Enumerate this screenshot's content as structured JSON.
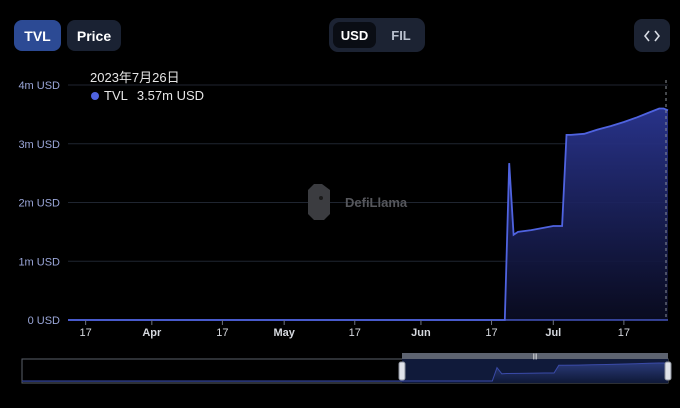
{
  "toolbar": {
    "tvl_label": "TVL",
    "price_label": "Price",
    "denom_usd": "USD",
    "denom_fil": "FIL",
    "embed_icon": "code-brackets-icon"
  },
  "tooltip": {
    "date": "2023年7月26日",
    "series": "TVL",
    "value": "3.57m USD"
  },
  "watermark": "DefiLlama",
  "colors": {
    "background": "#000000",
    "line": "#4f63e0",
    "fill_top": "#2a3590",
    "active_tab": "#2c4a94"
  },
  "chart_data": {
    "type": "area",
    "series": [
      {
        "name": "TVL",
        "x": [
          "2023-03-13",
          "2023-06-20",
          "2023-06-21",
          "2023-06-22",
          "2023-06-23",
          "2023-06-26",
          "2023-07-01",
          "2023-07-03",
          "2023-07-04",
          "2023-07-05",
          "2023-07-08",
          "2023-07-11",
          "2023-07-14",
          "2023-07-17",
          "2023-07-20",
          "2023-07-23",
          "2023-07-25",
          "2023-07-26",
          "2023-07-27"
        ],
        "values": [
          0,
          0,
          2.67,
          1.45,
          1.5,
          1.53,
          1.6,
          1.6,
          3.15,
          3.15,
          3.17,
          3.24,
          3.3,
          3.37,
          3.45,
          3.54,
          3.6,
          3.6,
          3.57
        ]
      }
    ],
    "x_ticks": [
      {
        "date": "2023-03-17",
        "label": "17"
      },
      {
        "date": "2023-04-01",
        "label": "Apr"
      },
      {
        "date": "2023-04-17",
        "label": "17"
      },
      {
        "date": "2023-05-01",
        "label": "May"
      },
      {
        "date": "2023-05-17",
        "label": "17"
      },
      {
        "date": "2023-06-01",
        "label": "Jun"
      },
      {
        "date": "2023-06-17",
        "label": "17"
      },
      {
        "date": "2023-07-01",
        "label": "Jul"
      },
      {
        "date": "2023-07-17",
        "label": "17"
      }
    ],
    "y_ticks": [
      {
        "value": 0,
        "label": "0 USD"
      },
      {
        "value": 1,
        "label": "1m USD"
      },
      {
        "value": 2,
        "label": "2m USD"
      },
      {
        "value": 3,
        "label": "3m USD"
      },
      {
        "value": 4,
        "label": "4m USD"
      }
    ],
    "x_range": [
      "2023-03-13",
      "2023-07-27"
    ],
    "ylim": [
      0,
      4
    ],
    "y_unit": "million USD",
    "grid": true,
    "legend": "none",
    "zoom_selection": [
      "2023-06-01",
      "2023-07-27"
    ]
  }
}
